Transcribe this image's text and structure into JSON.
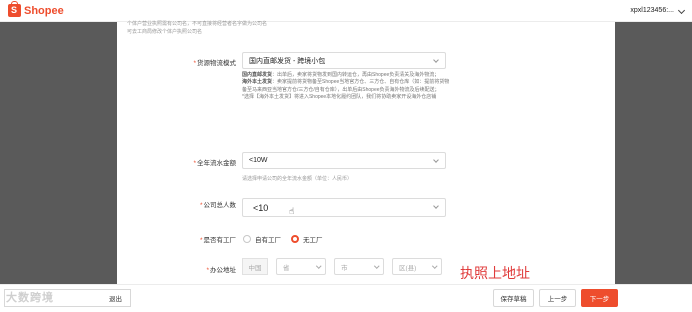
{
  "header": {
    "logo_text": "Shopee",
    "logo_glyph": "S",
    "user": "xpxl123456:..."
  },
  "top_note": {
    "line1": "个体户营业执照需有公司名，不可直接将经营者名字做为公司名",
    "line2": "可去工商局修改个体户执照公司名"
  },
  "logistics": {
    "label": "货源物流模式",
    "value": "国内直邮发货 - 跨境小包",
    "desc": [
      {
        "term": "国内直邮发货",
        "text": "：出单后，卖家将货物发到国内转运仓，再由Shopee负责清关及海外物流；"
      },
      {
        "term": "海外本土发货",
        "text": "：卖家提前将货物备至Shopee当地官方仓、三方仓、自有仓库（如：提前将货物备至马来西亚当地官方仓/三方仓/自有仓库），出单后由Shopee负责海外物流及后续配送；"
      },
      {
        "term": "",
        "text": "*选择【海外本土发货】将进入Shopee本地化履约团队，我们将协助卖家开设海外仓店铺"
      }
    ]
  },
  "turnover": {
    "label": "全年流水金额",
    "value": "<10W",
    "hint": "请选择申请公司的全年流水金额（单位：人民币）"
  },
  "employees": {
    "label": "公司总人数",
    "value": "<10"
  },
  "factory": {
    "label": "是否有工厂",
    "options": [
      "自有工厂",
      "无工厂"
    ],
    "selected": "无工厂"
  },
  "address": {
    "label": "办公地址",
    "country": "中国",
    "province_placeholder": "省",
    "city_placeholder": "市",
    "district_placeholder": "区(县)"
  },
  "annotation": "执照上地址",
  "footer": {
    "exit_label": "退出",
    "save_draft": "保存草稿",
    "prev": "上一步",
    "next": "下一步",
    "watermark": "大数跨境"
  },
  "colors": {
    "brand": "#ee4d2d",
    "annotation": "#e03b3b"
  }
}
